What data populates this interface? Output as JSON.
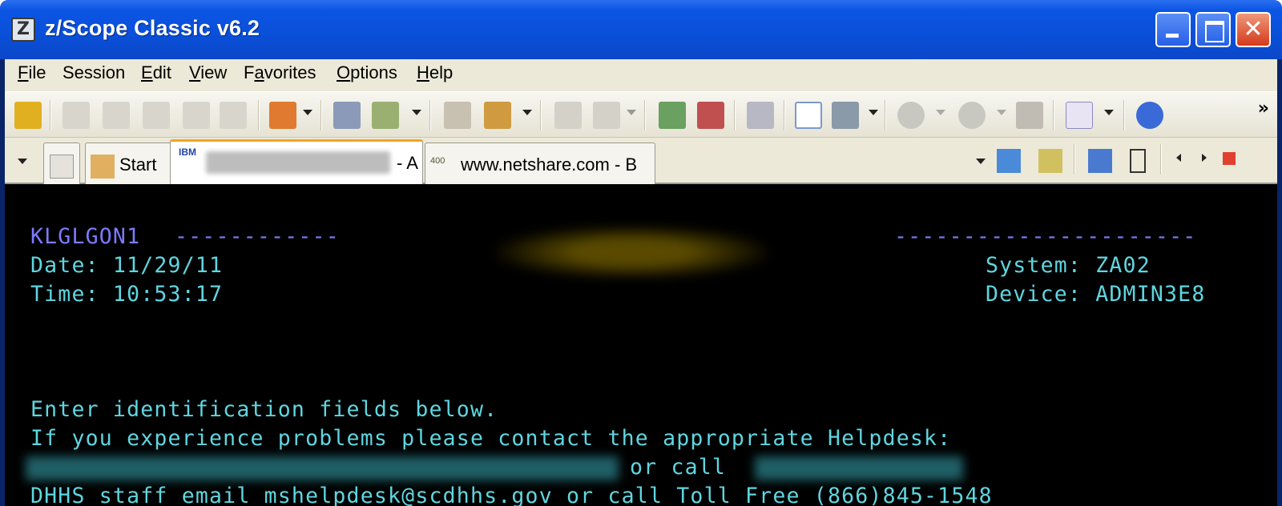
{
  "window": {
    "title": "z/Scope Classic v6.2",
    "app_icon_glyph": "Z",
    "buttons": {
      "minimize": "minimize-icon",
      "maximize": "maximize-icon",
      "close": "✕"
    }
  },
  "menubar": {
    "items": [
      {
        "label": "File",
        "accel": "F",
        "rest": "ile"
      },
      {
        "label": "Session",
        "accel": "",
        "rest": "Session"
      },
      {
        "label": "Edit",
        "accel": "E",
        "rest": "dit"
      },
      {
        "label": "View",
        "accel": "V",
        "rest": "iew"
      },
      {
        "label": "Favorites",
        "accel_pre": "F",
        "accel": "a",
        "rest": "vorites"
      },
      {
        "label": "Options",
        "accel": "O",
        "rest": "ptions"
      },
      {
        "label": "Help",
        "accel": "H",
        "rest": "elp"
      }
    ]
  },
  "toolbar": {
    "overflow": "»"
  },
  "tabs": {
    "start_label": "Start",
    "active_tab_vendor": "IBM",
    "active_tab_suffix": "- A",
    "second_tab_vendor": "400",
    "second_tab_label": "www.netshare.com - B"
  },
  "terminal": {
    "screen_id": "KLGLGON1",
    "dashes_left": "------------",
    "dashes_right": "----------------------",
    "date_line": "Date: 11/29/11",
    "time_line": "Time: 10:53:17",
    "system_line": "System: ZA02",
    "device_line": "Device: ADMIN3E8",
    "instruction_1": "Enter identification fields below.",
    "instruction_2": "If you experience problems please contact the appropriate Helpdesk:",
    "instruction_3_mid": "or call",
    "instruction_4": "DHHS staff email mshelpdesk@scdhhs.gov or call Toll Free (866)845-1548"
  },
  "colors": {
    "title_bar": "#0b55e4",
    "terminal_bg": "#000000",
    "terminal_protected": "#7b7bff",
    "terminal_text": "#5fd6e0",
    "active_tab_accent": "#f0a526"
  }
}
